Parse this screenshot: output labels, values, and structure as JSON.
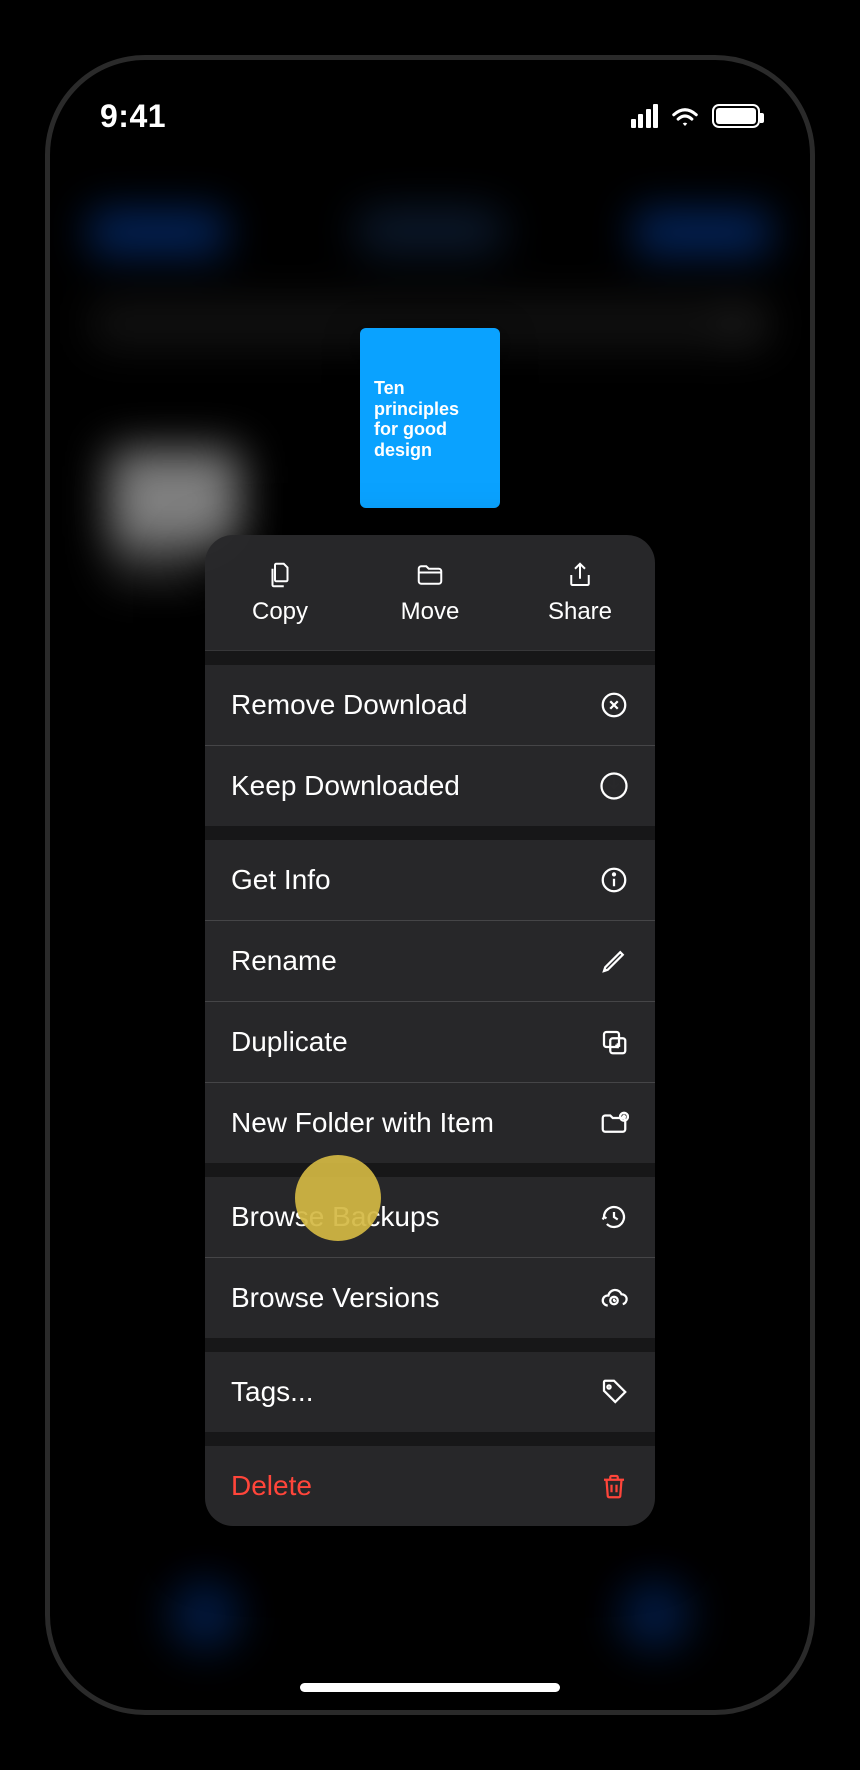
{
  "status": {
    "time": "9:41"
  },
  "preview": {
    "title_line1": "Ten",
    "title_line2": "principles",
    "title_line3": "for good",
    "title_line4": "design"
  },
  "topActions": {
    "copy": "Copy",
    "move": "Move",
    "share": "Share"
  },
  "menu": {
    "removeDownload": "Remove Download",
    "keepDownloaded": "Keep Downloaded",
    "getInfo": "Get Info",
    "rename": "Rename",
    "duplicate": "Duplicate",
    "newFolder": "New Folder with Item",
    "browseBackups": "Browse Backups",
    "browseVersions": "Browse Versions",
    "tags": "Tags...",
    "delete": "Delete"
  }
}
